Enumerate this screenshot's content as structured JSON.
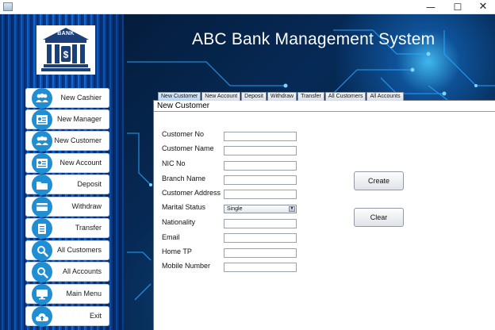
{
  "window": {
    "min_glyph": "—",
    "max_glyph": "☐",
    "close_glyph": "✕"
  },
  "header": {
    "title": "ABC Bank Management System"
  },
  "logo": {
    "label": "BANK",
    "icon": "bank-building-icon"
  },
  "sidebar": {
    "items": [
      {
        "label": "New Cashier",
        "icon": "users-icon"
      },
      {
        "label": "New Manager",
        "icon": "id-card-icon"
      },
      {
        "label": "New Customer",
        "icon": "users-icon"
      },
      {
        "label": "New Account",
        "icon": "id-card-icon"
      },
      {
        "label": "Deposit",
        "icon": "folder-icon"
      },
      {
        "label": "Withdraw",
        "icon": "credit-card-icon"
      },
      {
        "label": "Transfer",
        "icon": "document-icon"
      },
      {
        "label": "All Customers",
        "icon": "search-icon"
      },
      {
        "label": "All Accounts",
        "icon": "search-icon"
      },
      {
        "label": "Main Menu",
        "icon": "monitor-icon"
      },
      {
        "label": "Exit",
        "icon": "cloud-upload-icon"
      }
    ]
  },
  "tabs": [
    {
      "label": "New Customer",
      "active": true
    },
    {
      "label": "New Account",
      "active": false
    },
    {
      "label": "Deposit",
      "active": false
    },
    {
      "label": "Withdraw",
      "active": false
    },
    {
      "label": "Transfer",
      "active": false
    },
    {
      "label": "All Customers",
      "active": false
    },
    {
      "label": "All Accounts",
      "active": false
    }
  ],
  "form": {
    "title": "New Customer",
    "fields": {
      "customer_no": {
        "label": "Customer No",
        "value": ""
      },
      "customer_name": {
        "label": "Customer Name",
        "value": ""
      },
      "nic_no": {
        "label": "NIC No",
        "value": ""
      },
      "branch_name": {
        "label": "Branch Name",
        "value": ""
      },
      "customer_address": {
        "label": "Customer Address",
        "value": ""
      },
      "marital_status": {
        "label": "Marital Status",
        "value": "Single"
      },
      "nationality": {
        "label": "Nationality",
        "value": ""
      },
      "email": {
        "label": "Email",
        "value": ""
      },
      "home_tp": {
        "label": "Home TP",
        "value": ""
      },
      "mobile_number": {
        "label": "Mobile Number",
        "value": ""
      }
    },
    "create_label": "Create",
    "clear_label": "Clear"
  },
  "colors": {
    "accent": "#1f8ed3",
    "sidebar": "#1266d8",
    "background": "#062a56"
  }
}
